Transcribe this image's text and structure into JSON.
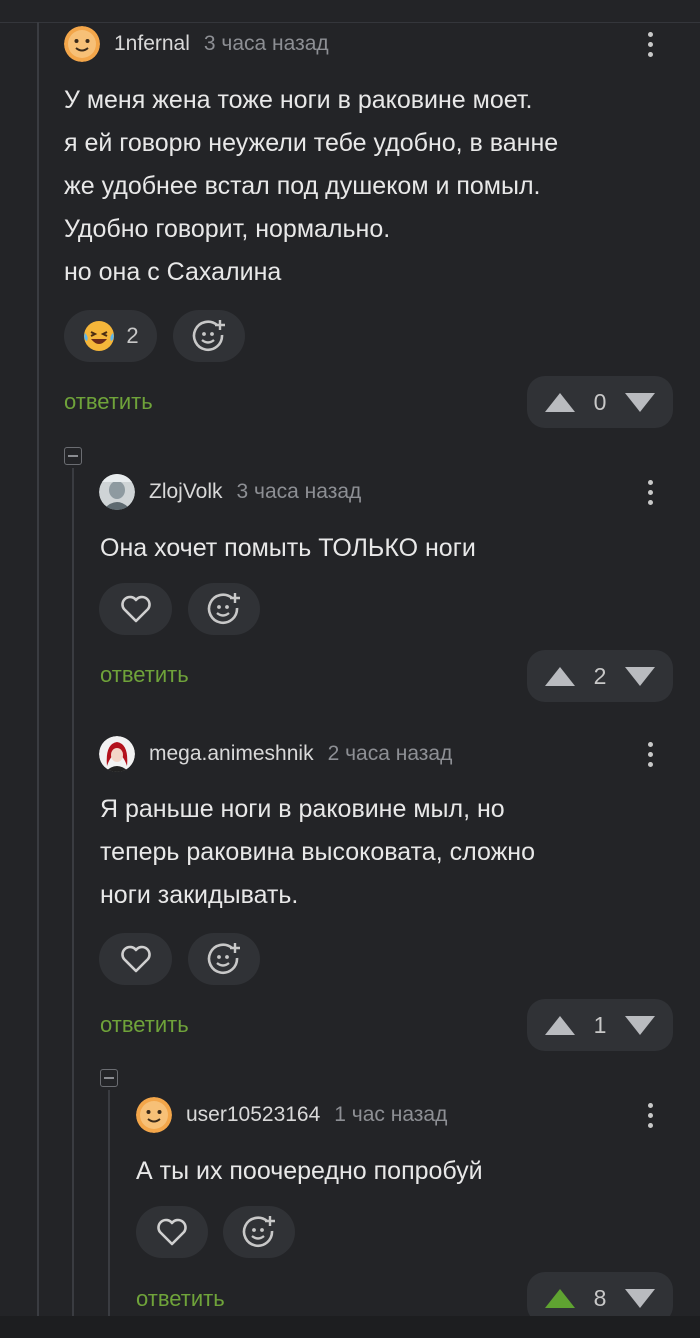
{
  "comments": [
    {
      "author": "1nfernal",
      "time": "3 часа назад",
      "lines": [
        "У меня жена тоже ноги в раковине моет.",
        "я ей говорю неужели тебе удобно, в ванне",
        "же удобнее встал под душеком и помыл.",
        "Удобно говорит, нормально.",
        "но она с Сахалина"
      ],
      "reaction": {
        "icon": "laughing-tears-emoji-icon",
        "count": "2"
      },
      "reply_label": "ответить",
      "rating": "0"
    },
    {
      "author": "ZlojVolk",
      "time": "3 часа назад",
      "lines": [
        "Она хочет помыть ТОЛЬКО ноги"
      ],
      "reply_label": "ответить",
      "rating": "2"
    },
    {
      "author": "mega.animeshnik",
      "time": "2 часа назад",
      "lines": [
        "Я раньше ноги в раковине мыл, но",
        "теперь раковина высоковата, сложно",
        "ноги закидывать."
      ],
      "reply_label": "ответить",
      "rating": "1"
    },
    {
      "author": "user10523164",
      "time": "1 час назад",
      "lines": [
        "А ты их поочередно попробуй"
      ],
      "reply_label": "ответить",
      "rating": "8",
      "upvoted": true
    }
  ],
  "colors": {
    "background": "#232427",
    "button_bg": "#303236",
    "reply_green": "#6fa33a",
    "upvote_active": "#5fa331",
    "muted_text": "#8d8f94"
  }
}
